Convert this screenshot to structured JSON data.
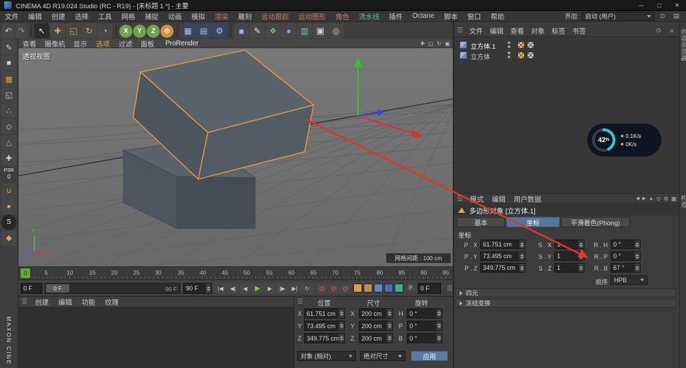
{
  "title_bar": {
    "title": "CINEMA 4D R19.024 Studio (RC - R19) - [未标题 1 *] - 主要"
  },
  "window_controls": {
    "minimize": "─",
    "maximize": "□",
    "close": "×"
  },
  "menu_bar": {
    "items": [
      {
        "label": "文件"
      },
      {
        "label": "编辑"
      },
      {
        "label": "创建"
      },
      {
        "label": "选择"
      },
      {
        "label": "工具"
      },
      {
        "label": "网格"
      },
      {
        "label": "捕捉"
      },
      {
        "label": "动画"
      },
      {
        "label": "模拟"
      },
      {
        "label": "渲染",
        "style": "color:#cb7a6a"
      },
      {
        "label": "雕刻"
      },
      {
        "label": "运动跟踪",
        "style": "color:#cb7a6a"
      },
      {
        "label": "运动图形",
        "style": "color:#cb7a6a"
      },
      {
        "label": "角色",
        "style": "color:#cb7a6a"
      },
      {
        "label": "流水线",
        "style": "color:#63b9a4"
      },
      {
        "label": "插件"
      },
      {
        "label": "Octane"
      },
      {
        "label": "脚本"
      },
      {
        "label": "窗口"
      },
      {
        "label": "帮助"
      }
    ],
    "interface_label": "界面:",
    "interface_value": "启动 (用户)",
    "right_icons": [
      {
        "glyph": "⊙"
      },
      {
        "glyph": "▤"
      }
    ]
  },
  "toolbar": {
    "items": [
      {
        "glyph": "↶"
      },
      {
        "glyph": "↷"
      },
      {
        "glyph": "↖"
      },
      {
        "glyph": "✚"
      },
      {
        "glyph": "◱"
      },
      {
        "glyph": "↻"
      },
      {
        "glyph": "◔"
      },
      {
        "glyph": "X"
      },
      {
        "glyph": "Y"
      },
      {
        "glyph": "Z"
      },
      {
        "glyph": "⊕"
      },
      {
        "glyph": "▦"
      },
      {
        "glyph": "▤"
      },
      {
        "glyph": "⚙"
      },
      {
        "glyph": "■"
      },
      {
        "glyph": "✎"
      },
      {
        "glyph": "❖"
      },
      {
        "glyph": "●"
      },
      {
        "glyph": "▥"
      },
      {
        "glyph": "▣"
      },
      {
        "glyph": "◎"
      }
    ]
  },
  "left_toolbar": {
    "items": [
      {
        "glyph": "✎"
      },
      {
        "glyph": "■"
      },
      {
        "glyph": "▦"
      },
      {
        "glyph": "◱"
      },
      {
        "glyph": "∴"
      },
      {
        "glyph": "◇"
      },
      {
        "glyph": "△"
      },
      {
        "glyph": "✚"
      },
      {
        "glyph": "∪"
      },
      {
        "glyph": "●"
      },
      {
        "glyph": "S"
      },
      {
        "glyph": "◆"
      }
    ],
    "psr_label": "PSR",
    "psr_value": "0",
    "brand": "MAXON CINE"
  },
  "viewport": {
    "menu": [
      {
        "label": "查看"
      },
      {
        "label": "摄像机"
      },
      {
        "label": "显示"
      },
      {
        "label": "选项",
        "style": "color:#e2a24a"
      },
      {
        "label": "过滤"
      },
      {
        "label": "面板"
      }
    ],
    "prorender": "ProRender",
    "corner_icons": [
      {
        "glyph": "✚"
      },
      {
        "glyph": "◱"
      },
      {
        "glyph": "↻"
      },
      {
        "glyph": "▣"
      }
    ],
    "view_label": "透视视图",
    "grid_label": "网格间距 : 100 cm",
    "axes": {
      "x": "X",
      "y": "Y",
      "z": "Z"
    }
  },
  "timeline": {
    "marker": "0",
    "ticks": [
      "5",
      "10",
      "15",
      "20",
      "25",
      "30",
      "35",
      "40",
      "45",
      "50",
      "55",
      "60",
      "65",
      "70",
      "75",
      "80",
      "85",
      "90",
      "95"
    ]
  },
  "transport": {
    "start_field": "0 F",
    "slider_handle": "0 F",
    "slider_max": "90 F",
    "end_field": "90 F",
    "buttons": [
      {
        "glyph": "|◀"
      },
      {
        "glyph": "◀|"
      },
      {
        "glyph": "◀"
      },
      {
        "glyph": "▶"
      },
      {
        "glyph": "▶"
      },
      {
        "glyph": "|▶"
      },
      {
        "glyph": "▶|"
      },
      {
        "glyph": "↻"
      }
    ],
    "record_buttons": [
      {
        "glyph": "⊘"
      },
      {
        "glyph": "⊘"
      },
      {
        "glyph": "⊘"
      }
    ],
    "p_toggle": "P",
    "frame_field": "0 F"
  },
  "material_panel": {
    "menu": [
      {
        "label": "创建"
      },
      {
        "label": "编辑"
      },
      {
        "label": "功能"
      },
      {
        "label": "纹理"
      }
    ]
  },
  "coord_panel": {
    "headers": [
      "位置",
      "尺寸",
      "旋转"
    ],
    "rows": [
      {
        "pa": "X",
        "pos": "61.751 cm",
        "sa": "X",
        "size": "200 cm",
        "ra": "H",
        "rot": "0 °"
      },
      {
        "pa": "Y",
        "pos": "73.495 cm",
        "sa": "Y",
        "size": "200 cm",
        "ra": "P",
        "rot": "0 °"
      },
      {
        "pa": "Z",
        "pos": "349.775 cm",
        "sa": "Z",
        "size": "200 cm",
        "ra": "B",
        "rot": "0 °"
      }
    ],
    "mode_dropdown": "对象 (相对)",
    "size_dropdown": "绝对尺寸",
    "apply_button": "应用"
  },
  "object_manager": {
    "menu": [
      {
        "label": "文件"
      },
      {
        "label": "编辑"
      },
      {
        "label": "查看"
      },
      {
        "label": "对象"
      },
      {
        "label": "标签"
      },
      {
        "label": "书签"
      }
    ],
    "icons": [
      {
        "glyph": "⊙"
      },
      {
        "glyph": "≡"
      }
    ],
    "objects": [
      {
        "name": "立方体.1"
      },
      {
        "name": "立方体"
      }
    ]
  },
  "monitor": {
    "percent": "42",
    "unit": "%",
    "down": "0.1K/s",
    "up": "0K/s"
  },
  "attributes": {
    "menu": [
      {
        "label": "模式"
      },
      {
        "label": "编辑"
      },
      {
        "label": "用户数据"
      }
    ],
    "icons": [
      {
        "glyph": "◀"
      },
      {
        "glyph": "▶"
      },
      {
        "glyph": "▲"
      },
      {
        "glyph": "⊙"
      },
      {
        "glyph": "⚙"
      },
      {
        "glyph": "▦"
      }
    ],
    "title": "多边形对象 [立方体.1]",
    "tabs": [
      {
        "label": "基本"
      },
      {
        "label": "坐标"
      },
      {
        "label": "平滑着色(Phong)"
      }
    ],
    "section": "坐标",
    "fields": [
      {
        "label": "P . X",
        "value": "61.751 cm"
      },
      {
        "label": "S . X",
        "value": "1"
      },
      {
        "label": "R . H",
        "value": "0 °"
      },
      {
        "label": "P . Y",
        "value": "73.495 cm"
      },
      {
        "label": "S . Y",
        "value": "1"
      },
      {
        "label": "R . P",
        "value": "0 °"
      },
      {
        "label": "P . Z",
        "value": "349.775 cm"
      },
      {
        "label": "S . Z",
        "value": "1"
      },
      {
        "label": "R . B",
        "value": "67 °"
      }
    ],
    "order_label": "顺序",
    "order_value": "HPB",
    "collapsed": [
      {
        "label": "四元"
      },
      {
        "label": "冻结变换"
      }
    ]
  },
  "right_strip": {
    "tabs": [
      {
        "label": "内容浏览器"
      },
      {
        "label": "构造"
      }
    ]
  },
  "colors": {
    "selection_orange": "#e89b3a",
    "active_tab_blue": "#56759b",
    "play_green": "#7ed63f",
    "annotation_red": "#e0352b",
    "gauge_teal": "#22d3c5"
  }
}
